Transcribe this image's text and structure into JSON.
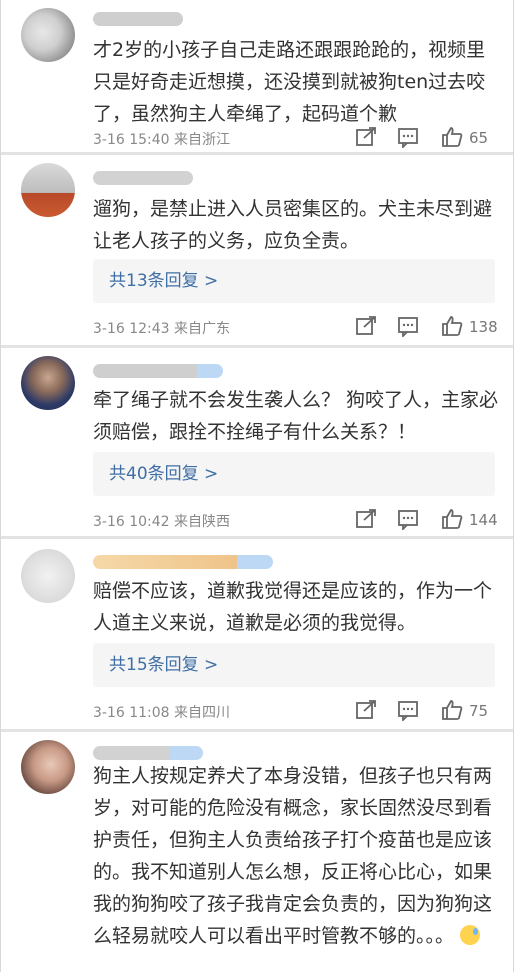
{
  "comments": [
    {
      "text": "才2岁的小孩子自己走路还跟跟跄跄的，视频里只是好奇走近想摸，还没摸到就被狗ten过去咬了，虽然狗主人牵绳了，起码道个歉",
      "time": "3-16 15:40",
      "location": "来自浙江",
      "likes": "65",
      "reply_label": ""
    },
    {
      "text": "遛狗，是禁止进入人员密集区的。犬主未尽到避让老人孩子的义务，应负全责。",
      "time": "3-16 12:43",
      "location": "来自广东",
      "likes": "138",
      "reply_label": "共13条回复 >"
    },
    {
      "text": "牵了绳子就不会发生袭人么？ 狗咬了人，主家必须赔偿，跟拴不拴绳子有什么关系？！",
      "time": "3-16 10:42",
      "location": "来自陕西",
      "likes": "144",
      "reply_label": "共40条回复 >"
    },
    {
      "text": "赔偿不应该，道歉我觉得还是应该的，作为一个人道主义来说，道歉是必须的我觉得。",
      "time": "3-16 11:08",
      "location": "来自四川",
      "likes": "75",
      "reply_label": "共15条回复 >"
    },
    {
      "text": "狗主人按规定养犬了本身没错，但孩子也只有两岁，对可能的危险没有概念，家长固然没尽到看护责任，但狗主人负责给孩子打个疫苗也是应该的。我不知道别人怎么想，反正将心比心，如果我的狗狗咬了孩子我肯定会负责的，因为狗狗这么轻易就咬人可以看出平时管教不够的。。。",
      "time": "",
      "location": "",
      "likes": "",
      "reply_label": ""
    }
  ],
  "icons": {
    "share": "share-icon",
    "comment": "comment-icon",
    "like": "thumbs-up-icon",
    "emoji": "sweat-smile-emoji-icon"
  },
  "colors": {
    "reply_link": "#3f6ea5",
    "separator": "#e3e3e3"
  }
}
